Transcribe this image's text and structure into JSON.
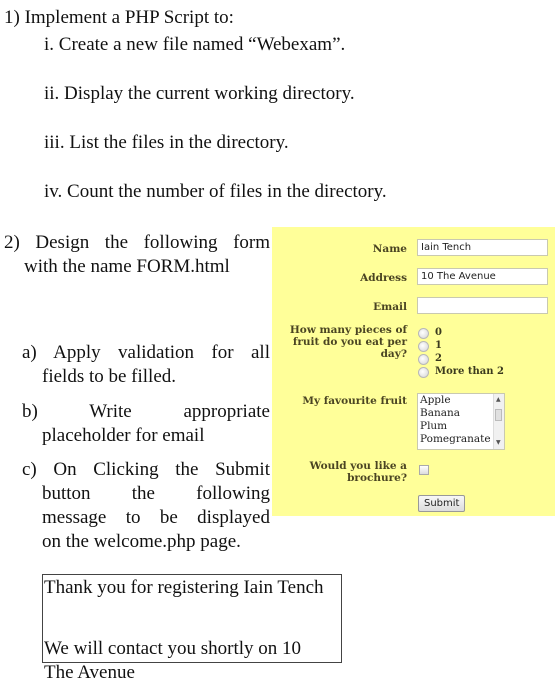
{
  "question1": {
    "title": "1) Implement a PHP Script to:",
    "items": [
      "i. Create a new file named “Webexam”.",
      "ii. Display the current working directory.",
      "iii. List the files in the directory.",
      "iv. Count the number of files in the directory."
    ]
  },
  "question2": {
    "title_first": "2) Design the following form",
    "title_rest": "with the name FORM.html",
    "sub_items": [
      {
        "first": "a) Apply validation for all",
        "rest": "fields to be filled."
      },
      {
        "first": "b) Write appropriate",
        "rest": "placeholder for email"
      },
      {
        "first": "c) On Clicking the Submit",
        "rest_lines": [
          "button the following",
          "message to be displayed",
          "on the welcome.php page."
        ]
      }
    ]
  },
  "message": {
    "line1": "Thank you for registering Iain Tench",
    "line2": "We will contact you shortly on 10 The Avenue"
  },
  "form": {
    "background_color": "#ffff99",
    "name_label": "Name",
    "name_value": "Iain Tench",
    "address_label": "Address",
    "address_value": "10 The Avenue",
    "email_label": "Email",
    "email_value": "",
    "fruit_count_label": "How many pieces of fruit do you eat per day?",
    "fruit_count_options": [
      "0",
      "1",
      "2",
      "More than 2"
    ],
    "favourite_fruit_label": "My favourite fruit",
    "favourite_fruit_options": [
      "Apple",
      "Banana",
      "Plum",
      "Pomegranate"
    ],
    "brochure_label": "Would you like a brochure?",
    "brochure_checked": false,
    "submit_label": "Submit"
  }
}
